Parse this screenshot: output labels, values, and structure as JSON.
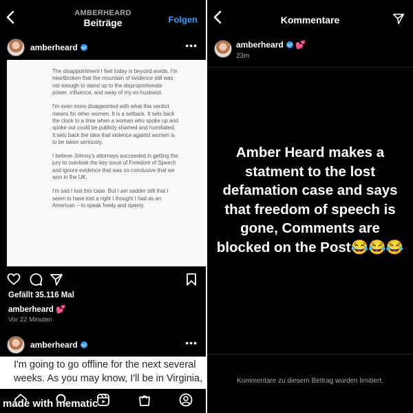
{
  "left": {
    "header": {
      "account": "AMBERHEARD",
      "title": "Beiträge",
      "follow_label": "Folgen"
    },
    "post1": {
      "username": "amberheard",
      "statement_paragraphs": [
        "The disappointment I feel today is beyond words. I'm heartbroken that the mountain of evidence still was not enough to stand up to the disproportionate power, influence, and sway of my ex-husband.",
        "I'm even more disappointed with what this verdict means for other women. It is a setback. It sets back the clock to a time when a woman who spoke up and spoke out could be publicly shamed and humiliated. It sets back the idea that violence against women is to be taken seriously.",
        "I believe Johnny's attorneys succeeded in getting the jury to overlook the key issue of Freedom of Speech and ignore evidence that was so conclusive that we won in the UK.",
        "I'm sad I lost this case. But I am sadder still that I seem to have lost a right I thought I had as an American – to speak freely and openly."
      ],
      "likes": "Gefällt 35.116 Mal",
      "caption_user": "amberheard",
      "caption_emoji": "💕",
      "time": "Vor 22 Minuten"
    },
    "post2": {
      "username": "amberheard",
      "text": "I'm going to go offline for the next several weeks. As you may know,  I'll be in Virginia,"
    },
    "icons": [
      "back-icon",
      "more-icon",
      "heart-icon",
      "comment-icon",
      "share-icon",
      "bookmark-icon",
      "home-icon",
      "search-icon",
      "reels-icon",
      "shop-icon",
      "profile-icon"
    ],
    "watermark": "made with mematic"
  },
  "right": {
    "header": {
      "title": "Kommentare"
    },
    "comment": {
      "username": "amberheard",
      "emoji": "💕",
      "time": "23m"
    },
    "overlay_text": "Amber Heard makes a statment to the lost defamation case and says that freedom of speech is gone, Comments are blocked on the Post😂😂😂",
    "limited_text": "Kommentare zu diesem Beitrag wurden limitiert."
  },
  "colors": {
    "background": "#000000",
    "accent": "#3897f0",
    "muted": "#a8a8a8",
    "verified": "#3897f0"
  }
}
